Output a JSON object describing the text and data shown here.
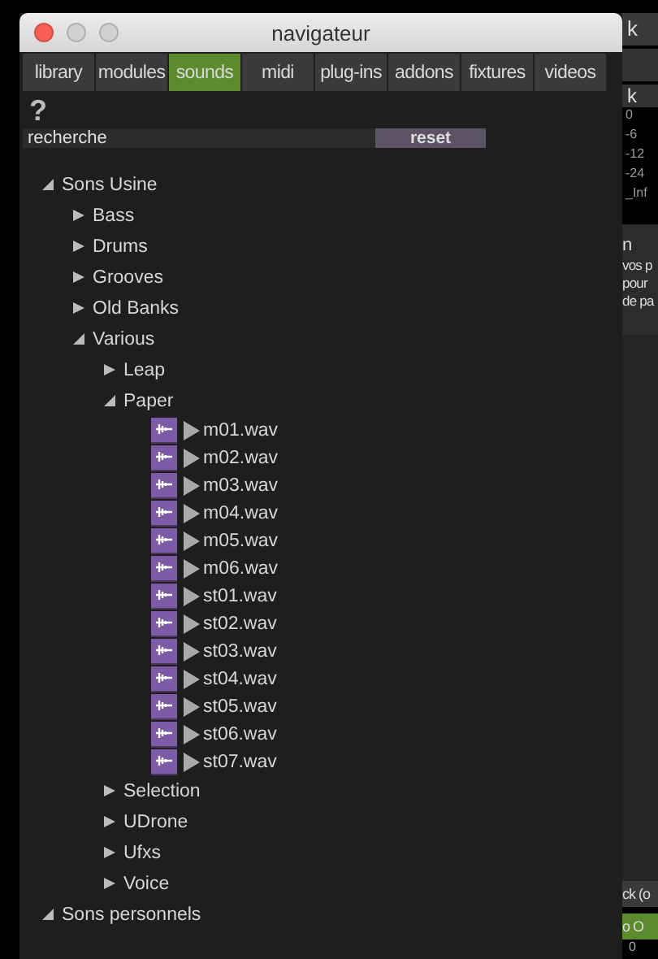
{
  "window": {
    "title": "navigateur"
  },
  "tabs": [
    {
      "label": "library",
      "selected": false
    },
    {
      "label": "modules",
      "selected": false
    },
    {
      "label": "sounds",
      "selected": true
    },
    {
      "label": "midi",
      "selected": false
    },
    {
      "label": "plug-ins",
      "selected": false
    },
    {
      "label": "addons",
      "selected": false
    },
    {
      "label": "fixtures",
      "selected": false
    },
    {
      "label": "videos",
      "selected": false
    }
  ],
  "help": "?",
  "search": {
    "placeholder": "recherche",
    "button": "reset"
  },
  "tree": [
    {
      "kind": "folder",
      "label": "Sons Usine",
      "expanded": true,
      "children": [
        {
          "kind": "folder",
          "label": "Bass",
          "expanded": false
        },
        {
          "kind": "folder",
          "label": "Drums",
          "expanded": false
        },
        {
          "kind": "folder",
          "label": "Grooves",
          "expanded": false
        },
        {
          "kind": "folder",
          "label": "Old Banks",
          "expanded": false
        },
        {
          "kind": "folder",
          "label": "Various",
          "expanded": true,
          "children": [
            {
              "kind": "folder",
              "label": "Leap",
              "expanded": false
            },
            {
              "kind": "folder",
              "label": "Paper",
              "expanded": true,
              "children": [
                {
                  "kind": "file",
                  "label": "m01.wav"
                },
                {
                  "kind": "file",
                  "label": "m02.wav"
                },
                {
                  "kind": "file",
                  "label": "m03.wav"
                },
                {
                  "kind": "file",
                  "label": "m04.wav"
                },
                {
                  "kind": "file",
                  "label": "m05.wav"
                },
                {
                  "kind": "file",
                  "label": "m06.wav"
                },
                {
                  "kind": "file",
                  "label": "st01.wav"
                },
                {
                  "kind": "file",
                  "label": "st02.wav"
                },
                {
                  "kind": "file",
                  "label": "st03.wav"
                },
                {
                  "kind": "file",
                  "label": "st04.wav"
                },
                {
                  "kind": "file",
                  "label": "st05.wav"
                },
                {
                  "kind": "file",
                  "label": "st06.wav"
                },
                {
                  "kind": "file",
                  "label": "st07.wav"
                }
              ]
            },
            {
              "kind": "folder",
              "label": "Selection",
              "expanded": false
            },
            {
              "kind": "folder",
              "label": "UDrone",
              "expanded": false
            },
            {
              "kind": "folder",
              "label": "Ufxs",
              "expanded": false
            },
            {
              "kind": "folder",
              "label": "Voice",
              "expanded": false
            }
          ]
        }
      ]
    },
    {
      "kind": "folder",
      "label": "Sons personnels",
      "expanded": true
    }
  ],
  "background_window": {
    "header_1": "k",
    "header_2": "k",
    "meter_scale": [
      "0",
      "-6",
      "-12",
      "-24",
      "_Inf"
    ],
    "panel_title": "n",
    "panel_text": [
      "vos p",
      "pour",
      "de pa"
    ],
    "footer_title": "ck (o",
    "footer_button": "o O",
    "footer_value": "0"
  }
}
